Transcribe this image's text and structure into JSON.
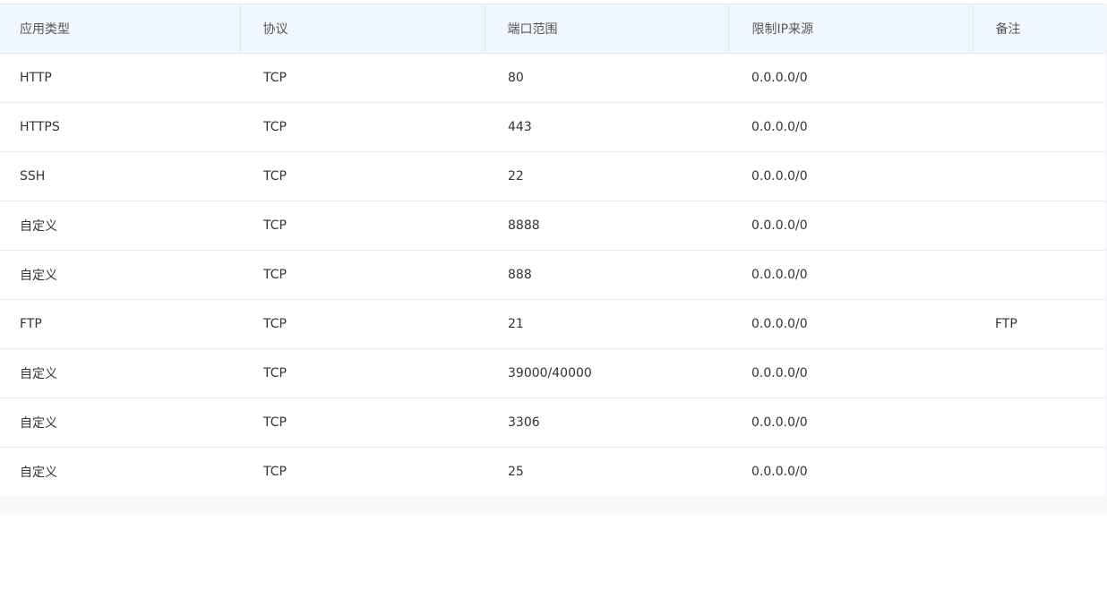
{
  "table": {
    "headers": [
      "应用类型",
      "协议",
      "端口范围",
      "限制IP来源",
      "备注"
    ],
    "rows": [
      [
        "HTTP",
        "TCP",
        "80",
        "0.0.0.0/0",
        ""
      ],
      [
        "HTTPS",
        "TCP",
        "443",
        "0.0.0.0/0",
        ""
      ],
      [
        "SSH",
        "TCP",
        "22",
        "0.0.0.0/0",
        ""
      ],
      [
        "自定义",
        "TCP",
        "8888",
        "0.0.0.0/0",
        ""
      ],
      [
        "自定义",
        "TCP",
        "888",
        "0.0.0.0/0",
        ""
      ],
      [
        "FTP",
        "TCP",
        "21",
        "0.0.0.0/0",
        "FTP"
      ],
      [
        "自定义",
        "TCP",
        "39000/40000",
        "0.0.0.0/0",
        ""
      ],
      [
        "自定义",
        "TCP",
        "3306",
        "0.0.0.0/0",
        ""
      ],
      [
        "自定义",
        "TCP",
        "25",
        "0.0.0.0/0",
        ""
      ]
    ]
  }
}
